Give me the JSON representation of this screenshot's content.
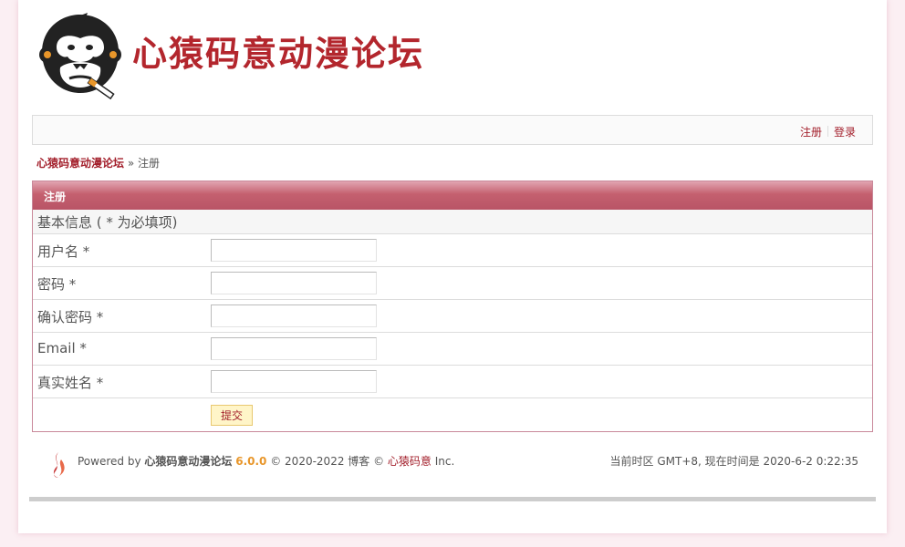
{
  "header": {
    "site_name": "心猿码意动漫论坛",
    "logo_icon": "gorilla-logo-icon"
  },
  "userlinks": {
    "register": "注册",
    "login": "登录"
  },
  "breadcrumb": {
    "home": "心猿码意动漫论坛",
    "separator": "»",
    "current": "注册"
  },
  "form": {
    "title": "注册",
    "section": "基本信息 ( * 为必填项)",
    "fields": [
      {
        "label": "用户名 *",
        "value": ""
      },
      {
        "label": "密码 *",
        "value": ""
      },
      {
        "label": "确认密码 *",
        "value": ""
      },
      {
        "label": "Email *",
        "value": ""
      },
      {
        "label": "真实姓名 *",
        "value": ""
      }
    ],
    "submit": "提交"
  },
  "footer": {
    "powered_by": "Powered by",
    "site_name": "心猿码意动漫论坛",
    "version": "6.0.0",
    "copyright": "© 2020-2022 博客 ©",
    "company": "心猿码意",
    "inc": "Inc.",
    "timezone_text": "当前时区 GMT+8, 现在时间是 2020-6-2 0:22:35"
  },
  "colors": {
    "brand_red": "#b3262d",
    "link_red": "#a3202c",
    "panel_header": "#c4606f",
    "version_orange": "#e8962a"
  }
}
